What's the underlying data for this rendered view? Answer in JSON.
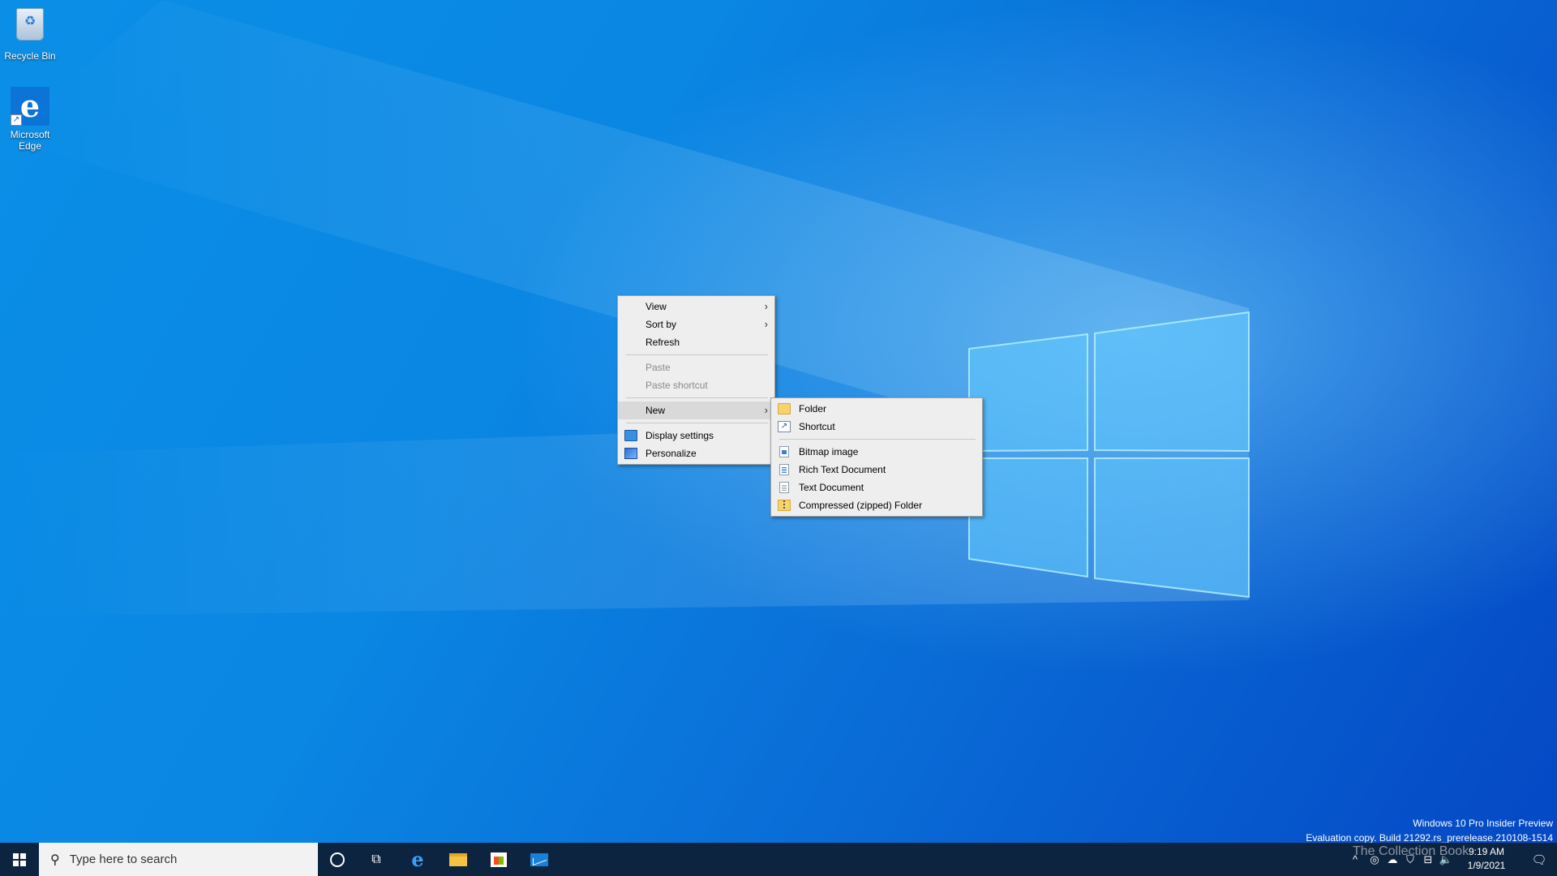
{
  "desktop": {
    "icons": [
      {
        "label": "Recycle Bin",
        "icon": "recycle-bin-icon"
      },
      {
        "label": "Microsoft Edge",
        "icon": "edge-icon"
      }
    ],
    "watermark": {
      "line1": "Windows 10 Pro Insider Preview",
      "line2": "Evaluation copy. Build 21292.rs_prerelease.210108-1514"
    }
  },
  "context_menu": {
    "items": [
      {
        "label": "View",
        "submenu": true
      },
      {
        "label": "Sort by",
        "submenu": true
      },
      {
        "label": "Refresh"
      },
      {
        "label": "Paste",
        "disabled": true
      },
      {
        "label": "Paste shortcut",
        "disabled": true
      },
      {
        "label": "New",
        "submenu": true,
        "highlighted": true
      },
      {
        "label": "Display settings",
        "icon": "display-settings-icon"
      },
      {
        "label": "Personalize",
        "icon": "personalize-icon"
      }
    ]
  },
  "new_submenu": {
    "items": [
      {
        "label": "Folder",
        "icon": "folder-icon"
      },
      {
        "label": "Shortcut",
        "icon": "shortcut-icon"
      },
      {
        "label": "Bitmap image",
        "icon": "bitmap-file-icon"
      },
      {
        "label": "Rich Text Document",
        "icon": "rtf-file-icon"
      },
      {
        "label": "Text Document",
        "icon": "text-file-icon"
      },
      {
        "label": "Compressed (zipped) Folder",
        "icon": "zip-folder-icon"
      }
    ]
  },
  "taskbar": {
    "search_placeholder": "Type here to search",
    "pinned": [
      "edge-icon",
      "file-explorer-icon",
      "store-icon",
      "mail-icon"
    ],
    "tray": {
      "time": "9:19 AM",
      "date": "1/9/2021",
      "overlay_text": "The Collection Book"
    }
  },
  "colors": {
    "taskbar": "#0d2440",
    "menu_bg": "#eeeeee",
    "menu_highlight": "#d9d9d9",
    "desktop_blue": "#0a86e3"
  }
}
